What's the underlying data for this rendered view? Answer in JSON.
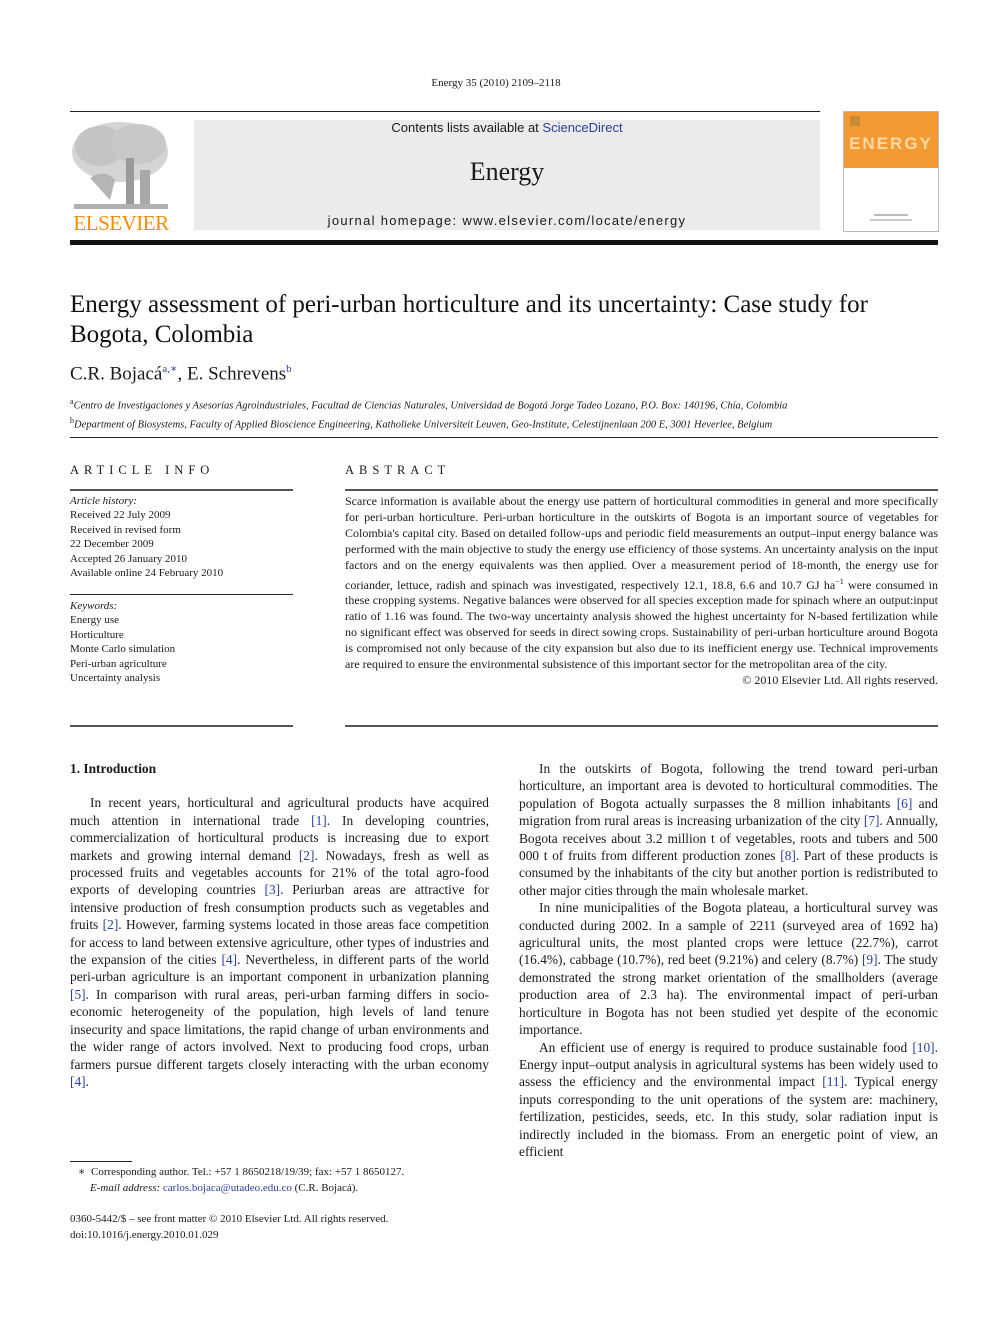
{
  "header": {
    "running_head": "Energy 35 (2010) 2109–2118",
    "contents_prefix": "Contents lists available at ",
    "contents_link": "ScienceDirect",
    "journal_name": "Energy",
    "homepage": "journal homepage: www.elsevier.com/locate/energy",
    "publisher_logo_text": "ELSEVIER",
    "cover_title": "ENERGY"
  },
  "article": {
    "title": "Energy assessment of peri-urban horticulture and its uncertainty: Case study for Bogota, Colombia",
    "authors": [
      {
        "name": "C.R. Bojacá",
        "marks": "a,∗"
      },
      {
        "name": "E. Schrevens",
        "marks": "b"
      }
    ],
    "affiliations": [
      {
        "mark": "a",
        "text": "Centro de Investigaciones y Asesorías Agroindustriales, Facultad de Ciencias Naturales, Universidad de Bogotá Jorge Tadeo Lozano, P.O. Box: 140196, Chía, Colombia"
      },
      {
        "mark": "b",
        "text": "Department of Biosystems, Faculty of Applied Bioscience Engineering, Katholieke Universiteit Leuven, Geo-Institute, Celestijnenlaan 200 E, 3001 Heverlee, Belgium"
      }
    ]
  },
  "article_info": {
    "heading": "ARTICLE INFO",
    "history_label": "Article history:",
    "history": [
      "Received 22 July 2009",
      "Received in revised form",
      "22 December 2009",
      "Accepted 26 January 2010",
      "Available online 24 February 2010"
    ],
    "keywords_label": "Keywords:",
    "keywords": [
      "Energy use",
      "Horticulture",
      "Monte Carlo simulation",
      "Peri-urban agriculture",
      "Uncertainty analysis"
    ]
  },
  "abstract": {
    "heading": "ABSTRACT",
    "text_before_sup": "Scarce information is available about the energy use pattern of horticultural commodities in general and more specifically for peri-urban horticulture. Peri-urban horticulture in the outskirts of Bogota is an important source of vegetables for Colombia's capital city. Based on detailed follow-ups and periodic field measurements an output–input energy balance was performed with the main objective to study the energy use efficiency of those systems. An uncertainty analysis on the input factors and on the energy equivalents was then applied. Over a measurement period of 18-month, the energy use for coriander, lettuce, radish and spinach was investigated, respectively 12.1, 18.8, 6.6 and 10.7 GJ ha",
    "sup": "−1",
    "text_after_sup": " were consumed in these cropping systems. Negative balances were observed for all species exception made for spinach where an output:input ratio of 1.16 was found. The two-way uncertainty analysis showed the highest uncertainty for N-based fertilization while no significant effect was observed for seeds in direct sowing crops. Sustainability of peri-urban horticulture around Bogota is compromised not only because of the city expansion but also due to its inefficient energy use. Technical improvements are required to ensure the environmental subsistence of this important sector for the metropolitan area of the city.",
    "copyright": "© 2010 Elsevier Ltd. All rights reserved."
  },
  "body": {
    "section_heading": "1.  Introduction",
    "left_paragraphs": [
      [
        {
          "t": "In recent years, horticultural and agricultural products have acquired much attention in international trade "
        },
        {
          "ref": "[1]"
        },
        {
          "t": ". In developing countries, commercialization of horticultural products is increasing due to export markets and growing internal demand "
        },
        {
          "ref": "[2]"
        },
        {
          "t": ". Nowadays, fresh as well as processed fruits and vegetables accounts for 21% of the total agro-food exports of developing countries "
        },
        {
          "ref": "[3]"
        },
        {
          "t": ". Periurban areas are attractive for intensive production of fresh consumption products such as vegetables and fruits "
        },
        {
          "ref": "[2]"
        },
        {
          "t": ". However, farming systems located in those areas face competition for access to land between extensive agriculture, other types of industries and the expansion of the cities "
        },
        {
          "ref": "[4]"
        },
        {
          "t": ". Nevertheless, in different parts of the world peri-urban agriculture is an important component in urbanization planning "
        },
        {
          "ref": "[5]"
        },
        {
          "t": ". In comparison with rural areas, peri-urban farming differs in socio-economic heterogeneity of the population, high levels of land tenure insecurity and space limitations, the rapid change of urban environments and the wider range of actors involved. Next to producing food crops, urban farmers pursue different targets closely interacting with the urban economy "
        },
        {
          "ref": "[4]"
        },
        {
          "t": "."
        }
      ]
    ],
    "right_paragraphs": [
      [
        {
          "t": "In the outskirts of Bogota, following the trend toward peri-urban horticulture, an important area is devoted to horticultural commodities. The population of Bogota actually surpasses the 8 million inhabitants "
        },
        {
          "ref": "[6]"
        },
        {
          "t": " and migration from rural areas is increasing urbanization of the city "
        },
        {
          "ref": "[7]"
        },
        {
          "t": ". Annually, Bogota receives about 3.2 million t of vegetables, roots and tubers and 500 000 t of fruits from different production zones "
        },
        {
          "ref": "[8]"
        },
        {
          "t": ". Part of these products is consumed by the inhabitants of the city but another portion is redistributed to other major cities through the main wholesale market."
        }
      ],
      [
        {
          "t": "In nine municipalities of the Bogota plateau, a horticultural survey was conducted during 2002. In a sample of 2211 (surveyed area of 1692 ha) agricultural units, the most planted crops were lettuce (22.7%), carrot (16.4%), cabbage (10.7%), red beet (9.21%) and celery (8.7%) "
        },
        {
          "ref": "[9]"
        },
        {
          "t": ". The study demonstrated the strong market orientation of the smallholders (average production area of 2.3 ha). The environmental impact of peri-urban horticulture in Bogota has not been studied yet despite of the economic importance."
        }
      ],
      [
        {
          "t": "An efficient use of energy is required to produce sustainable food "
        },
        {
          "ref": "[10]"
        },
        {
          "t": ". Energy input–output analysis in agricultural systems has been widely used to assess the efficiency and the environmental impact "
        },
        {
          "ref": "[11]"
        },
        {
          "t": ". Typical energy inputs corresponding to the unit operations of the system are: machinery, fertilization, pesticides, seeds, etc. In this study, solar radiation input is indirectly included in the biomass. From an energetic point of view, an efficient"
        }
      ]
    ]
  },
  "footnote": {
    "mark": "∗",
    "corresponding": "Corresponding author. Tel.: +57 1 8650218/19/39; fax: +57 1 8650127.",
    "email_label": "E-mail address: ",
    "email": "carlos.bojaca@utadeo.edu.co",
    "email_suffix": " (C.R. Bojacá)."
  },
  "front_matter": {
    "issn_line": "0360-5442/$ – see front matter © 2010 Elsevier Ltd. All rights reserved.",
    "doi": "doi:10.1016/j.energy.2010.01.029"
  }
}
